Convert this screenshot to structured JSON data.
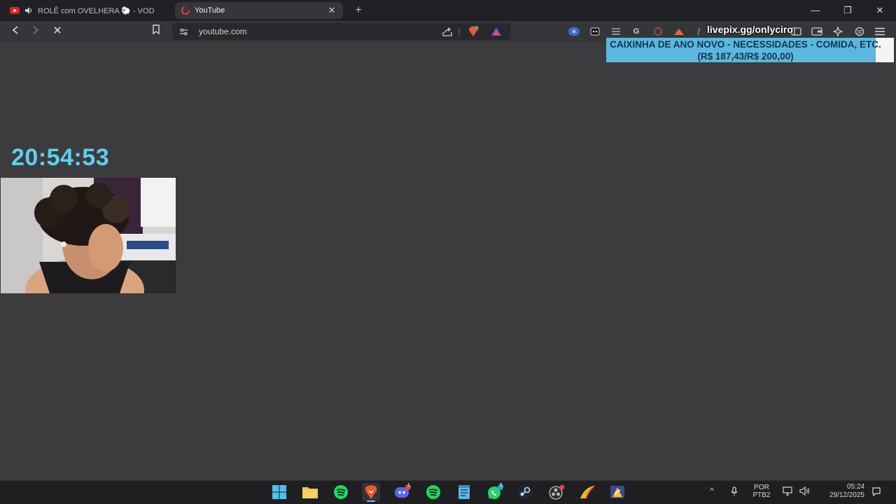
{
  "tabs": [
    {
      "title": "ROLÊ com OVELHERA 🐑 - VOD",
      "active": false,
      "audio": true,
      "favicon": "youtube-icon"
    },
    {
      "title": "YouTube",
      "active": true,
      "favicon": "loading-icon"
    }
  ],
  "toolbar": {
    "url": "youtube.com"
  },
  "overlay": {
    "livepix": "livepix.gg/onlyciro",
    "donation_line1": "CAIXINHA DE ANO NOVO - NECESSIDADES - COMIDA, ETC.",
    "donation_line2": "(R$ 187,43/R$ 200,00)",
    "donation_progress": 0.937,
    "clock": "20:54:53"
  },
  "taskbar": {
    "language": "POR",
    "layout": "PTB2",
    "time": "05:24",
    "date": "29/12/2025",
    "discord_badge": "1",
    "whatsapp_badge": "5"
  },
  "colors": {
    "page_background": "#3c3c3e",
    "banner": "#5bb7de",
    "clock": "#5fd0ea"
  }
}
